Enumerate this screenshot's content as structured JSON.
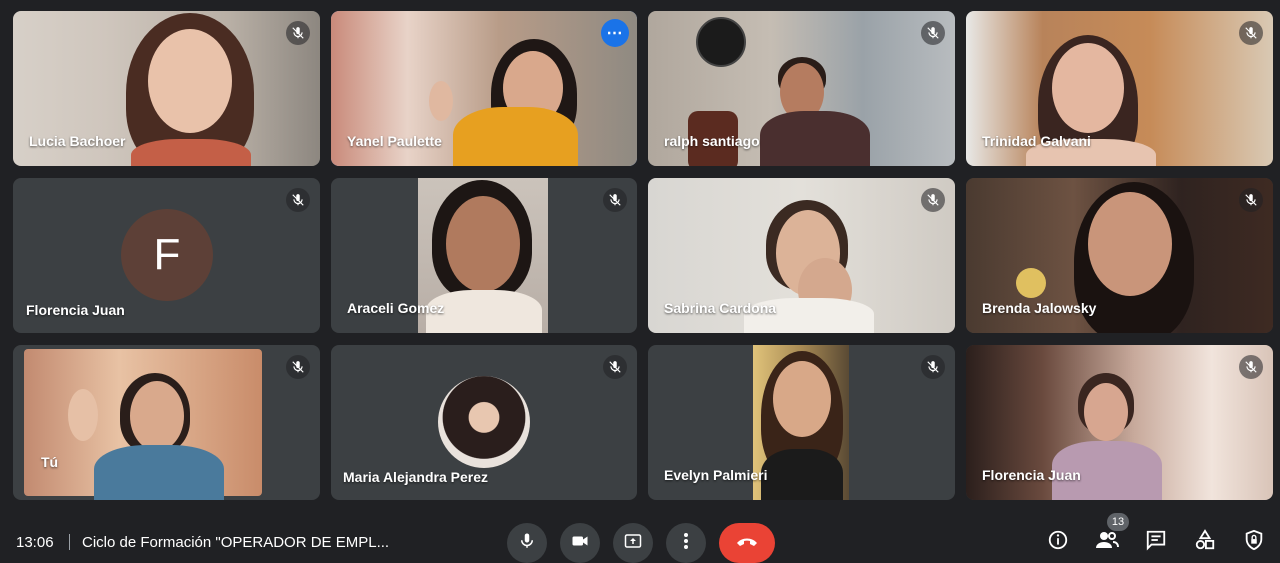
{
  "participants": [
    {
      "name": "Lucia Bachoer",
      "muted": true
    },
    {
      "name": "Yanel Paulette",
      "muted": false,
      "active_speaker": true
    },
    {
      "name": "ralph santiago",
      "muted": true
    },
    {
      "name": "Trinidad Galvani",
      "muted": true
    },
    {
      "name": "Florencia Juan",
      "muted": true,
      "avatar_letter": "F",
      "camera_off": true
    },
    {
      "name": "Araceli Gomez",
      "muted": true
    },
    {
      "name": "Sabrina Cardona",
      "muted": true
    },
    {
      "name": "Brenda Jalowsky",
      "muted": true
    },
    {
      "name": "Tú",
      "muted": true
    },
    {
      "name": "Maria Alejandra Perez",
      "muted": true,
      "camera_off": true
    },
    {
      "name": "Evelyn Palmieri",
      "muted": true
    },
    {
      "name": "Florencia Juan",
      "muted": true
    }
  ],
  "bottom_bar": {
    "time": "13:06",
    "meeting_title": "Ciclo de Formación \"OPERADOR DE EMPL...",
    "people_count": "13",
    "controls": [
      "mic-icon",
      "camera-icon",
      "present-icon",
      "more-vert-icon",
      "end-call-icon"
    ],
    "right_icons": [
      "info-icon",
      "people-icon",
      "chat-icon",
      "activities-icon",
      "host-controls-icon"
    ]
  },
  "colors": {
    "background": "#202124",
    "tile": "#3c4043",
    "active_border": "#669df6",
    "end_call": "#ea4335",
    "more_button": "#1a73e8"
  }
}
